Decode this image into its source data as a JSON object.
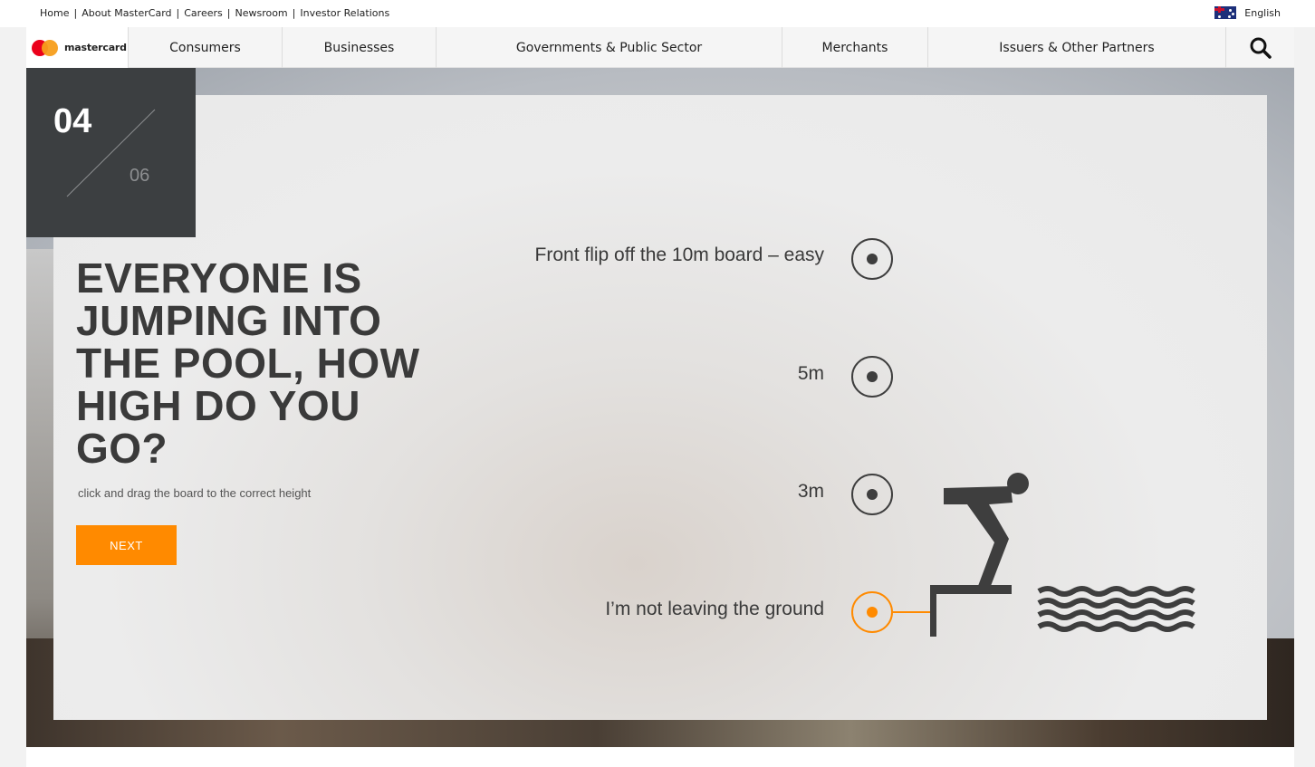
{
  "utility_nav": {
    "links": [
      "Home",
      "About MasterCard",
      "Careers",
      "Newsroom",
      "Investor Relations"
    ],
    "language": "English"
  },
  "brand": {
    "logo_text": "mastercard",
    "colors": {
      "red": "#eb001b",
      "orange": "#f79e1b",
      "accent": "#ff8a00"
    }
  },
  "main_nav": {
    "items": [
      "Consumers",
      "Businesses",
      "Governments & Public Sector",
      "Merchants",
      "Issuers & Other Partners"
    ],
    "search_icon": "search-icon"
  },
  "quiz": {
    "current": "04",
    "total": "06",
    "question": "EVERYONE IS JUMPING INTO THE POOL, HOW HIGH DO YOU GO?",
    "hint": "click and drag the board to the correct height",
    "next_label": "NEXT",
    "options": [
      {
        "label": "Front flip off the 10m board – easy",
        "selected": false
      },
      {
        "label": "5m",
        "selected": false
      },
      {
        "label": "3m",
        "selected": false
      },
      {
        "label": "I’m not leaving the ground",
        "selected": true
      }
    ]
  }
}
